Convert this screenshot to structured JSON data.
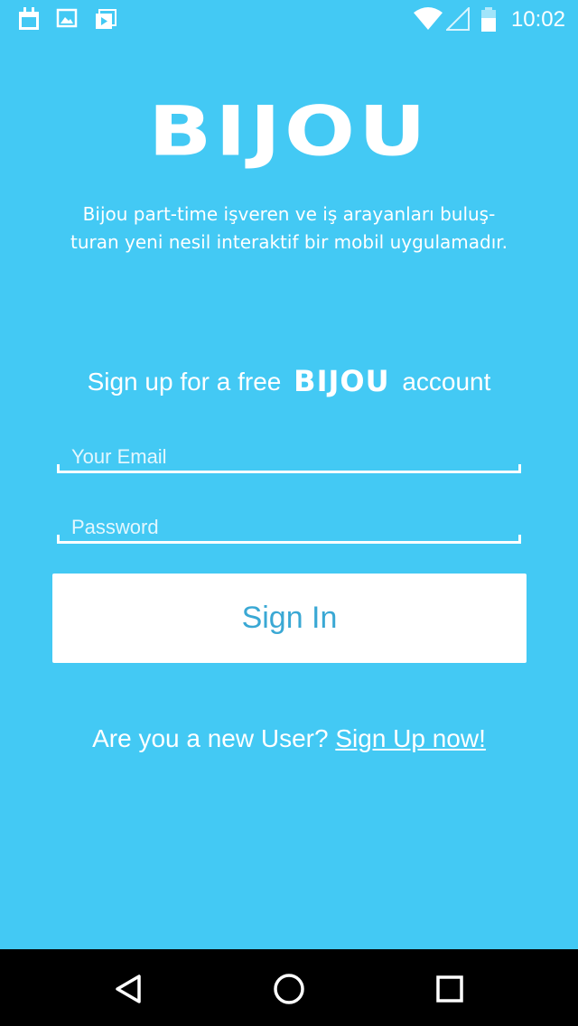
{
  "status_bar": {
    "time": "10:02",
    "left_icons": [
      "calendar-icon",
      "image-icon",
      "media-icon"
    ],
    "right_icons": [
      "wifi-icon",
      "cellular-signal-icon",
      "battery-icon"
    ]
  },
  "logo": {
    "text": "BIJOU"
  },
  "tagline": {
    "line1": "Bijou part-time işveren ve iş arayanları buluş-",
    "line2": "turan yeni nesil interaktif bir mobil uygulamadır."
  },
  "signup_prompt": {
    "before": "Sign up for a free",
    "brand": "BIJOU",
    "after": "account"
  },
  "form": {
    "email_placeholder": "Your Email",
    "email_value": "",
    "password_placeholder": "Password",
    "password_value": "",
    "signin_label": "Sign In"
  },
  "new_user": {
    "question": "Are you a new User?",
    "link": "Sign Up now!"
  },
  "nav_bar": {
    "icons": [
      "back-icon",
      "home-icon",
      "recents-icon"
    ]
  },
  "colors": {
    "background": "#43c9f4",
    "button_text": "#3aa8d4",
    "nav_bar": "#000000"
  }
}
